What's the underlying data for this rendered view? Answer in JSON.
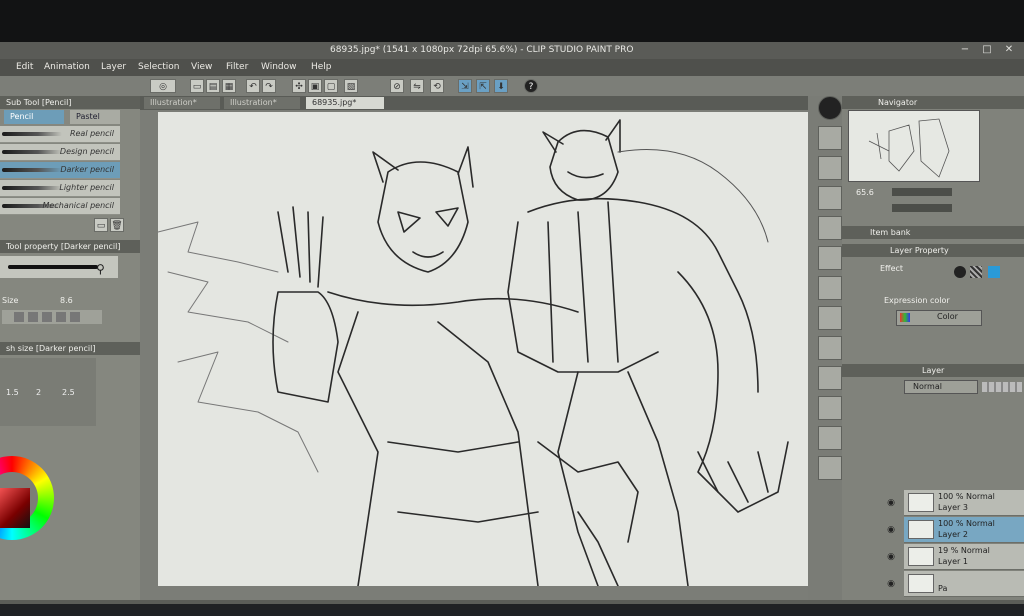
{
  "window": {
    "title": "68935.jpg* (1541 x 1080px 72dpi 65.6%) - CLIP STUDIO PAINT PRO"
  },
  "menu": [
    "Edit",
    "Animation",
    "Layer",
    "Selection",
    "View",
    "Filter",
    "Window",
    "Help"
  ],
  "doc_tabs": [
    "Illustration*",
    "Illustration*",
    "68935.jpg*"
  ],
  "subtool": {
    "header": "Sub Tool [Pencil]",
    "tabs": [
      "Pencil",
      "Pastel"
    ],
    "brushes": [
      "Real pencil",
      "Design pencil",
      "Darker pencil",
      "Lighter pencil",
      "Mechanical pencil"
    ],
    "selected_brush": "Darker pencil"
  },
  "tool_property": {
    "header": "Tool property [Darker pencil]",
    "size_label": "Size",
    "size_value": "8.6",
    "brush_size_header": "sh size [Darker pencil]",
    "size_presets": [
      "1.5",
      "2",
      "2.5"
    ]
  },
  "navigator": {
    "header": "Navigator",
    "zoom": "65.6",
    "item_bank": "Item bank"
  },
  "layer_property": {
    "header": "Layer Property",
    "effect_label": "Effect",
    "expression_color_label": "Expression color",
    "color_value": "Color"
  },
  "layer_panel": {
    "header": "Layer",
    "blend_mode": "Normal",
    "layers": [
      {
        "opacity": "100 % Normal",
        "name": "Layer 3"
      },
      {
        "opacity": "100 % Normal",
        "name": "Layer 2"
      },
      {
        "opacity": "19 % Normal",
        "name": "Layer 1"
      },
      {
        "opacity": "",
        "name": "Pa"
      }
    ],
    "selected_layer": "Layer 2"
  },
  "status": {
    "zoom": "65.6",
    "angle": "0"
  },
  "colors": {
    "accent": "#6d9db8",
    "paper": "#e4e6e1",
    "panel": "#85877f"
  }
}
